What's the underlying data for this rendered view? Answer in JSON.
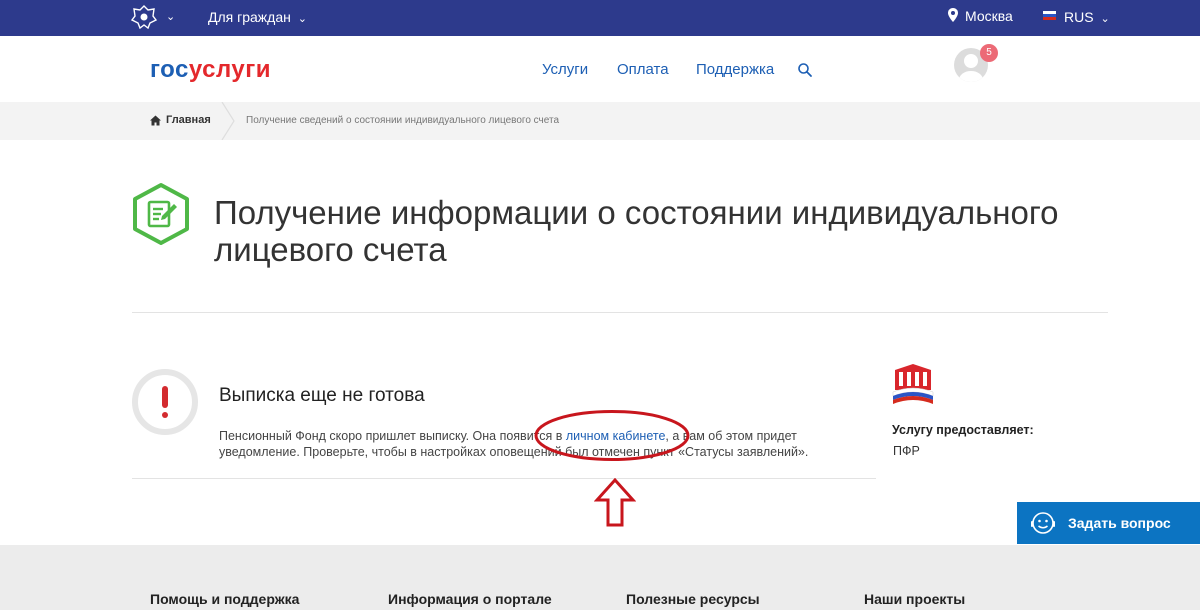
{
  "topbar": {
    "for_citizens": "Для граждан",
    "city": "Москва",
    "language": "RUS",
    "colors": {
      "bg": "#2d3a8c"
    }
  },
  "header": {
    "logo": {
      "part1": "гос",
      "part2": "услуги"
    },
    "nav": [
      "Услуги",
      "Оплата",
      "Поддержка"
    ],
    "notification_count": "5",
    "colors": {
      "link": "#1d5fb4",
      "logo_red": "#e4282c"
    }
  },
  "breadcrumb": {
    "home": "Главная",
    "current": "Получение сведений о состоянии индивидуального лицевого счета"
  },
  "page": {
    "title": "Получение информации о состоянии индивидуального лицевого счета",
    "status_title": "Выписка еще не готова",
    "status_text_before": "Пенсионный Фонд скоро пришлет выписку. Она появится в ",
    "status_link": "личном кабинете",
    "status_text_after": ", а вам об этом придет уведомление. Проверьте, чтобы в настройках оповещений был отмечен пункт «Статусы заявлений».",
    "colors": {
      "icon_green": "#4fb847",
      "alert_red": "#d32b2f",
      "annotation_red": "#c8161d"
    }
  },
  "provider": {
    "label": "Услугу предоставляет:",
    "name": "ПФР"
  },
  "ask_button": {
    "label": "Задать вопрос",
    "color": "#0c74c2"
  },
  "footer": {
    "columns": [
      "Помощь и поддержка",
      "Информация о портале",
      "Полезные ресурсы",
      "Наши проекты"
    ]
  }
}
